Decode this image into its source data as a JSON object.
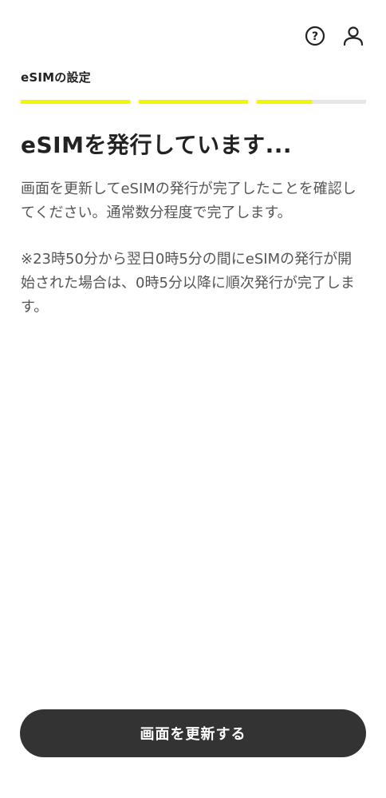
{
  "header": {
    "icons": [
      "help-icon",
      "account-icon"
    ],
    "help_symbol": "?"
  },
  "step": {
    "label": "eSIMの設定",
    "progress": {
      "segments": 3,
      "current_segment_fill": 0.5,
      "completed_segments": 2,
      "accent_color": "#f5f500",
      "track_color": "#e6e6e6"
    }
  },
  "main": {
    "title": "eSIMを発行しています...",
    "paragraphs": [
      "画面を更新してeSIMの発行が完了したことを確認してください。通常数分程度で完了します。",
      "※23時50分から翌日0時5分の間にeSIMの発行が開始された場合は、0時5分以降に順次発行が完了します。"
    ]
  },
  "footer": {
    "refresh_button_label": "画面を更新する",
    "button_color": "#333333"
  }
}
